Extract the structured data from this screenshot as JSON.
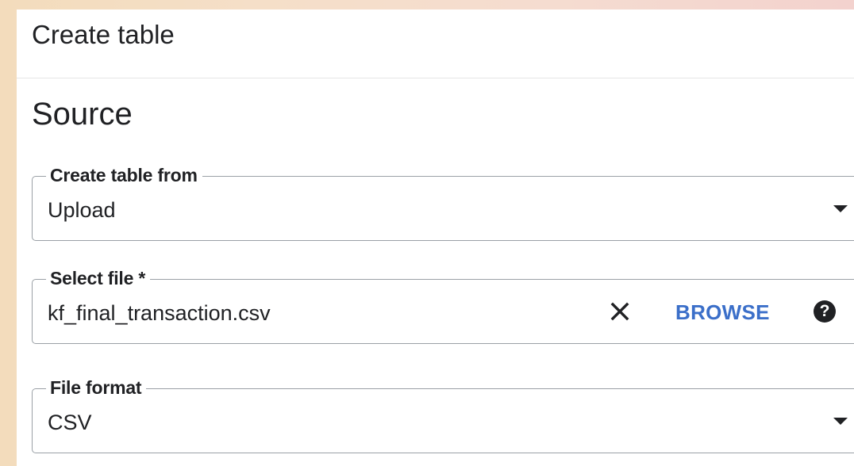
{
  "dialog": {
    "title": "Create table"
  },
  "source": {
    "section_title": "Source",
    "create_table_from": {
      "label": "Create table from",
      "value": "Upload"
    },
    "select_file": {
      "label": "Select file *",
      "value": "kf_final_transaction.csv",
      "browse_label": "BROWSE",
      "clear_icon": "close-icon",
      "help_icon": "help-icon",
      "help_glyph": "?"
    },
    "file_format": {
      "label": "File format",
      "value": "CSV"
    }
  },
  "colors": {
    "link": "#3b6fc9",
    "text": "#202124",
    "outline": "#9aa0a6"
  }
}
